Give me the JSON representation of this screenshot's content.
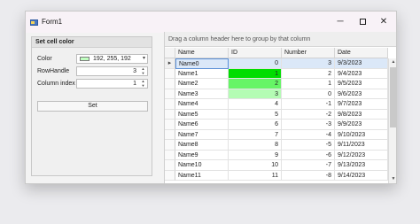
{
  "window": {
    "title": "Form1",
    "minimize": "─",
    "close": "✕"
  },
  "panel": {
    "title": "Set cell color",
    "color_label": "Color",
    "color_value": "192, 255, 192",
    "rowhandle_label": "RowHandle",
    "rowhandle_value": "3",
    "column_label": "Column index",
    "column_value": "1",
    "set_label": "Set",
    "spin_up": "▲",
    "spin_down": "▼",
    "dropdown_arrow": "▾",
    "swatch_color": "#c0ffc0"
  },
  "grid": {
    "group_panel_text": "Drag a column header here to group by that column",
    "headers": [
      "Name",
      "ID",
      "Number",
      "Date"
    ],
    "focus_indicator": "▸",
    "rows": [
      {
        "name": "Name0",
        "id": "0",
        "number": "3",
        "date": "9/3/2023",
        "id_color": ""
      },
      {
        "name": "Name1",
        "id": "1",
        "number": "2",
        "date": "9/4/2023",
        "id_color": "#00dd00"
      },
      {
        "name": "Name2",
        "id": "2",
        "number": "1",
        "date": "9/5/2023",
        "id_color": "#66f566"
      },
      {
        "name": "Name3",
        "id": "3",
        "number": "0",
        "date": "9/6/2023",
        "id_color": "#b4fcb4"
      },
      {
        "name": "Name4",
        "id": "4",
        "number": "-1",
        "date": "9/7/2023",
        "id_color": ""
      },
      {
        "name": "Name5",
        "id": "5",
        "number": "-2",
        "date": "9/8/2023",
        "id_color": ""
      },
      {
        "name": "Name6",
        "id": "6",
        "number": "-3",
        "date": "9/9/2023",
        "id_color": ""
      },
      {
        "name": "Name7",
        "id": "7",
        "number": "-4",
        "date": "9/10/2023",
        "id_color": ""
      },
      {
        "name": "Name8",
        "id": "8",
        "number": "-5",
        "date": "9/11/2023",
        "id_color": ""
      },
      {
        "name": "Name9",
        "id": "9",
        "number": "-6",
        "date": "9/12/2023",
        "id_color": ""
      },
      {
        "name": "Name10",
        "id": "10",
        "number": "-7",
        "date": "9/13/2023",
        "id_color": ""
      },
      {
        "name": "Name11",
        "id": "11",
        "number": "-8",
        "date": "9/14/2023",
        "id_color": ""
      }
    ],
    "scroll_up": "▲",
    "scroll_down": "▼"
  }
}
